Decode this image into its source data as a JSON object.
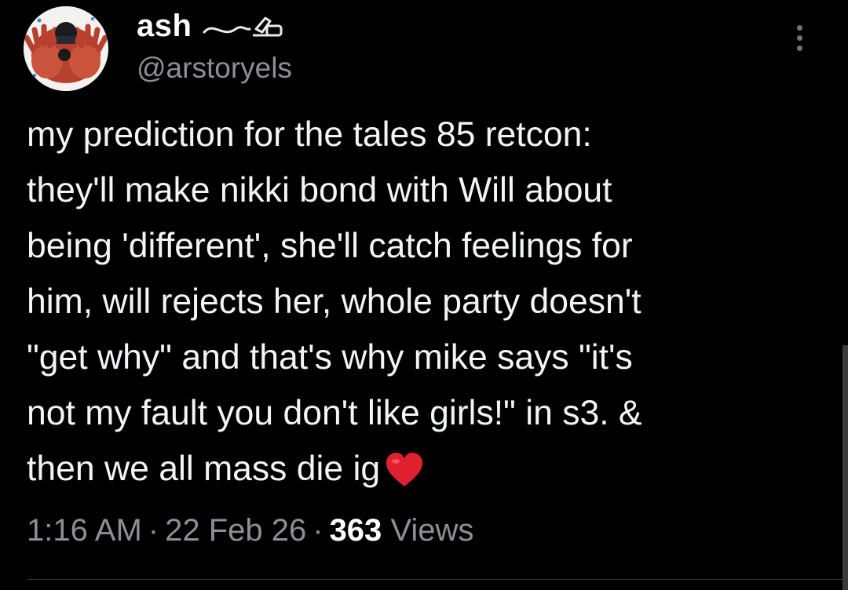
{
  "user": {
    "display_name": "ash",
    "handle": "@arstoryels",
    "avatar_icon": "avatar-hands-image",
    "name_decoration_icon": "writing-hand-icon"
  },
  "tweet": {
    "text": "my prediction for the tales 85 retcon:\nthey'll make nikki bond with Will about\nbeing 'different', she'll catch feelings for\nhim, will rejects her, whole party doesn't\n\"get why\" and that's why mike says \"it's\nnot my fault you don't like girls!\" in s3. &\nthen we all mass die ig",
    "emoji_icon": "red-heart-icon"
  },
  "meta": {
    "time": "1:16 AM",
    "separator": "·",
    "date": "22 Feb 26",
    "views_count": "363",
    "views_label": "Views"
  },
  "colors": {
    "background": "#000000",
    "text_primary": "#f2f4f5",
    "text_secondary": "#8b9096",
    "heart": "#e0202e"
  }
}
